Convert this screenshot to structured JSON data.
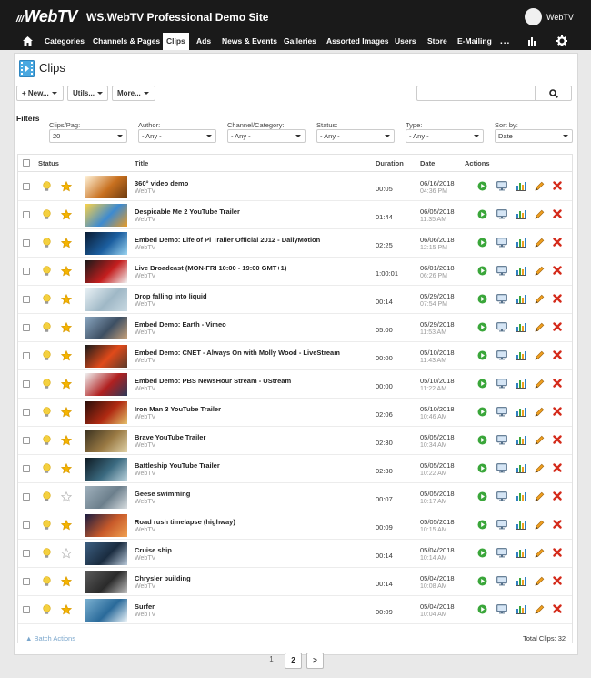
{
  "header": {
    "logo_text": "WebTV",
    "site_title": "WS.WebTV Professional Demo Site",
    "username": "WebTV"
  },
  "nav": {
    "items": [
      "Categories",
      "Channels & Pages",
      "Clips",
      "Ads",
      "News & Events",
      "Galleries",
      "Assorted Images",
      "Users",
      "Store",
      "E-Mailing"
    ],
    "active": "Clips",
    "more": "..."
  },
  "page": {
    "title": "Clips"
  },
  "toolbar": {
    "new_label": "+ New...",
    "utils_label": "Utils...",
    "more_label": "More..."
  },
  "search": {
    "value": "",
    "placeholder": ""
  },
  "filters": {
    "title": "Filters",
    "clips_per_page": {
      "label": "Clips/Pag:",
      "value": "20"
    },
    "author": {
      "label": "Author:",
      "value": "- Any -"
    },
    "channel": {
      "label": "Channel/Category:",
      "value": "- Any -"
    },
    "status": {
      "label": "Status:",
      "value": "- Any -"
    },
    "type": {
      "label": "Type:",
      "value": "- Any -"
    },
    "sort_by": {
      "label": "Sort by:",
      "value": "Date"
    }
  },
  "table": {
    "headers": {
      "status": "Status",
      "title": "Title",
      "duration": "Duration",
      "date": "Date",
      "actions": "Actions"
    },
    "rows": [
      {
        "title": "360° video demo",
        "author": "WebTV",
        "duration": "00:05",
        "date": "06/16/2018",
        "time": "04:36 PM",
        "featured": true
      },
      {
        "title": "Despicable Me 2 YouTube Trailer",
        "author": "WebTV",
        "duration": "01:44",
        "date": "06/05/2018",
        "time": "11:35 AM",
        "featured": true
      },
      {
        "title": "Embed Demo: Life of Pi Trailer Official 2012 - DailyMotion",
        "author": "WebTV",
        "duration": "02:25",
        "date": "06/06/2018",
        "time": "12:15 PM",
        "featured": true
      },
      {
        "title": "Live Broadcast (MON-FRI 10:00 - 19:00 GMT+1)",
        "author": "WebTV",
        "duration": "1:00:01",
        "date": "06/01/2018",
        "time": "06:26 PM",
        "featured": true
      },
      {
        "title": "Drop falling into liquid",
        "author": "WebTV",
        "duration": "00:14",
        "date": "05/29/2018",
        "time": "07:54 PM",
        "featured": true
      },
      {
        "title": "Embed Demo: Earth - Vimeo",
        "author": "WebTV",
        "duration": "05:00",
        "date": "05/29/2018",
        "time": "11:53 AM",
        "featured": true
      },
      {
        "title": "Embed Demo: CNET - Always On with Molly Wood - LiveStream",
        "author": "WebTV",
        "duration": "00:00",
        "date": "05/10/2018",
        "time": "11:43 AM",
        "featured": true
      },
      {
        "title": "Embed Demo: PBS NewsHour Stream - UStream",
        "author": "WebTV",
        "duration": "00:00",
        "date": "05/10/2018",
        "time": "11:22 AM",
        "featured": true
      },
      {
        "title": "Iron Man 3 YouTube Trailer",
        "author": "WebTV",
        "duration": "02:06",
        "date": "05/10/2018",
        "time": "10:46 AM",
        "featured": true
      },
      {
        "title": "Brave YouTube Trailer",
        "author": "WebTV",
        "duration": "02:30",
        "date": "05/05/2018",
        "time": "10:34 AM",
        "featured": true
      },
      {
        "title": "Battleship YouTube Trailer",
        "author": "WebTV",
        "duration": "02:30",
        "date": "05/05/2018",
        "time": "10:22 AM",
        "featured": true
      },
      {
        "title": "Geese swimming",
        "author": "WebTV",
        "duration": "00:07",
        "date": "05/05/2018",
        "time": "10:17 AM",
        "featured": false
      },
      {
        "title": "Road rush timelapse (highway)",
        "author": "WebTV",
        "duration": "00:09",
        "date": "05/05/2018",
        "time": "10:15 AM",
        "featured": true
      },
      {
        "title": "Cruise ship",
        "author": "WebTV",
        "duration": "00:14",
        "date": "05/04/2018",
        "time": "10:14 AM",
        "featured": false
      },
      {
        "title": "Chrysler building",
        "author": "WebTV",
        "duration": "00:14",
        "date": "05/04/2018",
        "time": "10:08 AM",
        "featured": true
      },
      {
        "title": "Surfer",
        "author": "WebTV",
        "duration": "00:09",
        "date": "05/04/2018",
        "time": "10:04 AM",
        "featured": true
      }
    ],
    "batch_actions": "Batch Actions",
    "total": "Total Clips: 32"
  },
  "pagination": {
    "pages": [
      "1",
      "2"
    ],
    "current": "2",
    "next": ">"
  },
  "colors": {
    "topbar": "#1a1a1a",
    "play": "#3aa63a",
    "edit": "#f0a020",
    "delete": "#d42a1a",
    "star": "#f5b400",
    "bulb": "#f4d03f"
  },
  "icons": {
    "status_bulb": "lightbulb-icon",
    "featured": "star-icon",
    "play": "play-icon",
    "preview": "monitor-icon",
    "stats": "bar-chart-icon",
    "edit": "pencil-icon",
    "delete": "delete-icon"
  }
}
